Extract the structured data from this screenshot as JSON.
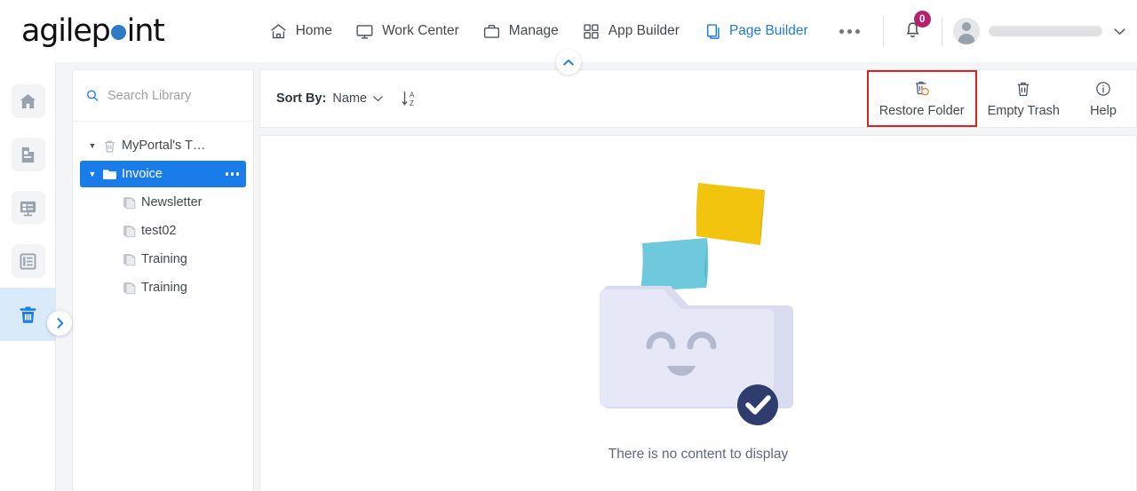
{
  "app": {
    "brand_name": "agilepoint",
    "brand_dot_color": "#2e7ac4"
  },
  "header": {
    "nav": [
      {
        "label": "Home",
        "icon": "home-icon",
        "active": false
      },
      {
        "label": "Work Center",
        "icon": "monitor-icon",
        "active": false
      },
      {
        "label": "Manage",
        "icon": "briefcase-icon",
        "active": false
      },
      {
        "label": "App Builder",
        "icon": "grid-squares-icon",
        "active": false
      },
      {
        "label": "Page Builder",
        "icon": "copy-pages-icon",
        "active": true
      }
    ],
    "overflow_label": "...",
    "notifications": {
      "icon": "bell-icon",
      "count": "0",
      "badge_color": "#b5216d"
    },
    "user": {
      "name": "",
      "avatar_icon": "user-avatar-icon",
      "chevron": "⌄"
    },
    "active_nav_color": "#1f7ae0"
  },
  "collapse_toggle": {
    "icon": "chevron-up-icon"
  },
  "rail": {
    "items": [
      {
        "name": "home",
        "icon": "home-icon",
        "active": false
      },
      {
        "name": "page",
        "icon": "document-icon",
        "active": false
      },
      {
        "name": "form",
        "icon": "form-layout-icon",
        "active": false
      },
      {
        "name": "list",
        "icon": "list-layout-icon",
        "active": false
      },
      {
        "name": "trash",
        "icon": "trash-icon",
        "active": true
      }
    ],
    "expand_button": {
      "icon": "chevron-right-icon"
    },
    "active_color": "#1a7ce8",
    "active_bg": "#d9eaf9"
  },
  "library": {
    "search": {
      "placeholder": "Search Library",
      "value": "",
      "icon": "search-icon"
    },
    "tree": [
      {
        "label": "MyPortal's T…",
        "icon": "trash-icon",
        "caret": "▼",
        "level": 0,
        "selected": false,
        "has_menu": false
      },
      {
        "label": "Invoice",
        "icon": "folder-icon",
        "caret": "▼",
        "level": 1,
        "selected": true,
        "has_menu": true,
        "menu_icon": "ellipsis-icon"
      },
      {
        "label": "Newsletter",
        "icon": "pages-icon",
        "level": 2,
        "selected": false,
        "has_menu": false
      },
      {
        "label": "test02",
        "icon": "pages-icon",
        "level": 2,
        "selected": false,
        "has_menu": false
      },
      {
        "label": "Training",
        "icon": "pages-icon",
        "level": 2,
        "selected": false,
        "has_menu": false
      },
      {
        "label": "Training",
        "icon": "pages-icon",
        "level": 2,
        "selected": false,
        "has_menu": false
      }
    ],
    "selected_bg": "#1a7ce8"
  },
  "toolbar": {
    "sort_label": "Sort By:",
    "sort_value": "Name",
    "sort_chevron": "⌄",
    "sort_direction_icon": "sort-alpha-asc-icon",
    "actions": [
      {
        "label": "Restore Folder",
        "icon": "restore-folder-icon",
        "highlighted": true
      },
      {
        "label": "Empty Trash",
        "icon": "trash-icon",
        "highlighted": false
      },
      {
        "label": "Help",
        "icon": "info-circle-icon",
        "highlighted": false
      }
    ],
    "highlight_color": "#e32020"
  },
  "content": {
    "empty_message": "There is no content to display",
    "illustration": {
      "name": "empty-folder-illustration",
      "folder_color": "#e6e8f7",
      "paper_yellow": "#f2c40d",
      "paper_cyan": "#6ec9dd",
      "badge_color": "#2f3c6e",
      "badge_icon": "check-icon"
    }
  }
}
